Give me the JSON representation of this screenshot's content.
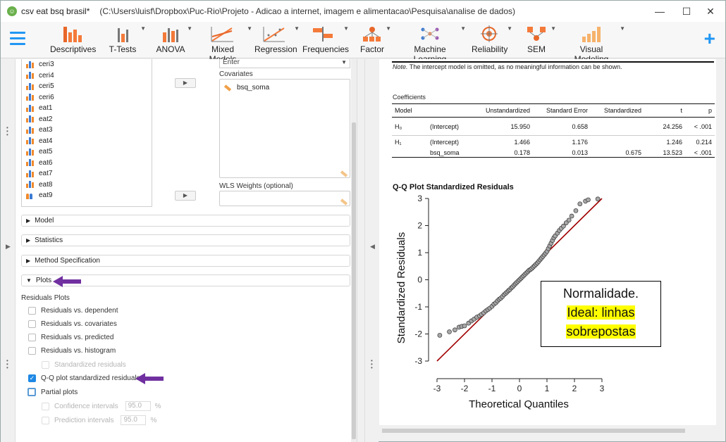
{
  "titlebar": {
    "app_title": "csv eat bsq brasil*",
    "path": "(C:\\Users\\luisf\\Dropbox\\Puc-Rio\\Projeto - Adicao a internet, imagem e alimentacao\\Pesquisa\\analise de dados)",
    "minimize": "—",
    "maximize": "☐",
    "close": "✕"
  },
  "ribbon": {
    "items": [
      {
        "label": "Descriptives"
      },
      {
        "label": "T-Tests"
      },
      {
        "label": "ANOVA"
      },
      {
        "label": "Mixed Models"
      },
      {
        "label": "Regression"
      },
      {
        "label": "Frequencies"
      },
      {
        "label": "Factor"
      },
      {
        "label": "Machine Learning"
      },
      {
        "label": "Reliability"
      },
      {
        "label": "SEM"
      },
      {
        "label": "Visual Modeling"
      }
    ],
    "plus": "+"
  },
  "variables": [
    "ceri3",
    "ceri4",
    "ceri5",
    "ceri6",
    "eat1",
    "eat2",
    "eat3",
    "eat4",
    "eat5",
    "eat6",
    "eat7",
    "eat8",
    "eat9"
  ],
  "assign": {
    "method_value": "Enter",
    "covariates_label": "Covariates",
    "covariate_item": "bsq_soma",
    "wls_label": "WLS Weights (optional)"
  },
  "sections": {
    "model": "Model",
    "statistics": "Statistics",
    "method_spec": "Method Specification",
    "plots": "Plots"
  },
  "plots": {
    "residuals_heading": "Residuals Plots",
    "res_vs_dependent": "Residuals vs. dependent",
    "res_vs_covariates": "Residuals vs. covariates",
    "res_vs_predicted": "Residuals vs. predicted",
    "res_vs_histogram": "Residuals vs. histogram",
    "standardized_residuals": "Standardized residuals",
    "qq_plot": "Q-Q plot standardized residuals",
    "partial_plots": "Partial plots",
    "confidence_intervals": "Confidence intervals",
    "confidence_value": "95.0",
    "prediction_intervals": "Prediction intervals",
    "prediction_value": "95.0",
    "percent": "%"
  },
  "output": {
    "note_prefix": "Note.",
    "note_text": " The intercept model is omitted, as no meaningful information can be shown.",
    "coef_title": "Coefficients",
    "headers": [
      "Model",
      "",
      "Unstandardized",
      "Standard Error",
      "Standardized",
      "t",
      "p"
    ],
    "rows": [
      {
        "model": "H₀",
        "term": "(Intercept)",
        "unstd": "15.950",
        "se": "0.658",
        "std": "",
        "t": "24.256",
        "p": "< .001"
      },
      {
        "model": "H₁",
        "term": "(Intercept)",
        "unstd": "1.466",
        "se": "1.176",
        "std": "",
        "t": "1.246",
        "p": "0.214"
      },
      {
        "model": "",
        "term": "bsq_soma",
        "unstd": "0.178",
        "se": "0.013",
        "std": "0.675",
        "t": "13.523",
        "p": "< .001"
      }
    ],
    "qq_title": "Q-Q Plot Standardized Residuals",
    "annotation_line1": "Normalidade.",
    "annotation_line2": "Ideal: linhas",
    "annotation_line3": "sobrepostas"
  },
  "chart_data": {
    "type": "scatter",
    "title": "",
    "xlabel": "Theoretical Quantiles",
    "ylabel": "Standardized Residuals",
    "xlim": [
      -3,
      3
    ],
    "ylim": [
      -3,
      3
    ],
    "xticks": [
      "-3",
      "-2",
      "-1",
      "0",
      "1",
      "2",
      "3"
    ],
    "yticks": [
      "-3",
      "-2",
      "-1",
      "0",
      "1",
      "2",
      "3"
    ],
    "reference_line": {
      "from": [
        -3,
        -3
      ],
      "to": [
        3,
        3
      ],
      "color": "#a00000"
    },
    "points": [
      [
        -2.9,
        -2.05
      ],
      [
        -2.55,
        -1.92
      ],
      [
        -2.35,
        -1.85
      ],
      [
        -2.2,
        -1.75
      ],
      [
        -2.1,
        -1.72
      ],
      [
        -2.0,
        -1.7
      ],
      [
        -1.85,
        -1.6
      ],
      [
        -1.75,
        -1.52
      ],
      [
        -1.65,
        -1.45
      ],
      [
        -1.55,
        -1.38
      ],
      [
        -1.45,
        -1.33
      ],
      [
        -1.38,
        -1.28
      ],
      [
        -1.3,
        -1.22
      ],
      [
        -1.22,
        -1.15
      ],
      [
        -1.15,
        -1.1
      ],
      [
        -1.08,
        -1.05
      ],
      [
        -1.0,
        -0.98
      ],
      [
        -0.93,
        -0.9
      ],
      [
        -0.86,
        -0.85
      ],
      [
        -0.8,
        -0.78
      ],
      [
        -0.74,
        -0.72
      ],
      [
        -0.68,
        -0.68
      ],
      [
        -0.62,
        -0.62
      ],
      [
        -0.56,
        -0.55
      ],
      [
        -0.5,
        -0.5
      ],
      [
        -0.45,
        -0.45
      ],
      [
        -0.4,
        -0.4
      ],
      [
        -0.35,
        -0.36
      ],
      [
        -0.3,
        -0.3
      ],
      [
        -0.25,
        -0.26
      ],
      [
        -0.2,
        -0.2
      ],
      [
        -0.15,
        -0.15
      ],
      [
        -0.1,
        -0.1
      ],
      [
        -0.05,
        -0.05
      ],
      [
        0.0,
        0.0
      ],
      [
        0.05,
        0.05
      ],
      [
        0.1,
        0.1
      ],
      [
        0.15,
        0.15
      ],
      [
        0.2,
        0.2
      ],
      [
        0.25,
        0.25
      ],
      [
        0.3,
        0.3
      ],
      [
        0.35,
        0.35
      ],
      [
        0.4,
        0.38
      ],
      [
        0.45,
        0.42
      ],
      [
        0.5,
        0.47
      ],
      [
        0.55,
        0.52
      ],
      [
        0.6,
        0.57
      ],
      [
        0.65,
        0.62
      ],
      [
        0.7,
        0.68
      ],
      [
        0.75,
        0.74
      ],
      [
        0.8,
        0.8
      ],
      [
        0.85,
        0.86
      ],
      [
        0.9,
        0.92
      ],
      [
        0.95,
        0.98
      ],
      [
        1.0,
        1.05
      ],
      [
        1.05,
        1.15
      ],
      [
        1.1,
        1.25
      ],
      [
        1.15,
        1.35
      ],
      [
        1.2,
        1.45
      ],
      [
        1.25,
        1.55
      ],
      [
        1.3,
        1.62
      ],
      [
        1.38,
        1.72
      ],
      [
        1.45,
        1.82
      ],
      [
        1.52,
        1.9
      ],
      [
        1.6,
        1.98
      ],
      [
        1.7,
        2.1
      ],
      [
        1.8,
        2.2
      ],
      [
        1.9,
        2.35
      ],
      [
        2.05,
        2.55
      ],
      [
        2.2,
        2.8
      ],
      [
        2.4,
        2.9
      ],
      [
        2.5,
        2.95
      ],
      [
        2.85,
        2.98
      ]
    ]
  }
}
